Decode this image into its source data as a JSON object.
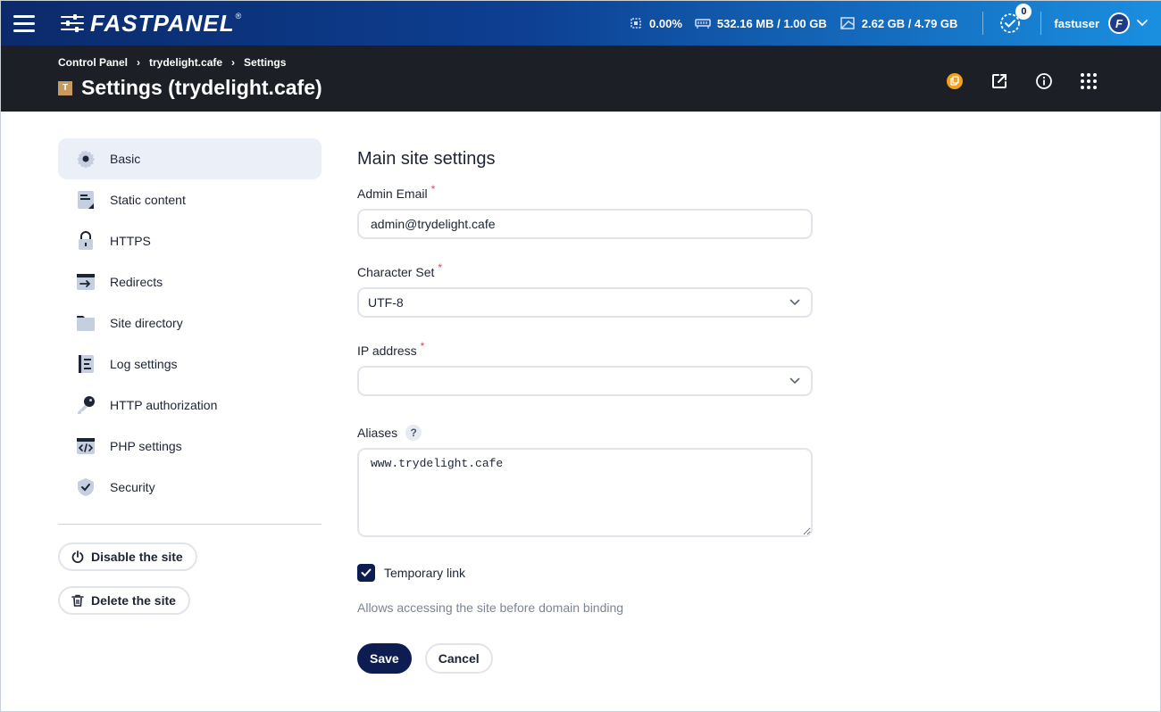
{
  "app": {
    "logo_text": "FASTPANEL",
    "logo_reg": "®"
  },
  "stats": {
    "cpu": "0.00%",
    "ram": "532.16 MB / 1.00 GB",
    "disk": "2.62 GB / 4.79 GB",
    "tasks_count": "0"
  },
  "user": {
    "name": "fastuser",
    "avatar_letter": "F"
  },
  "breadcrumb": [
    "Control Panel",
    "trydelight.cafe",
    "Settings"
  ],
  "page": {
    "site_badge": "T",
    "title": "Settings (trydelight.cafe)"
  },
  "sidebar": {
    "items": [
      {
        "label": "Basic",
        "icon": "gear-icon",
        "active": true
      },
      {
        "label": "Static content",
        "icon": "static-content-icon"
      },
      {
        "label": "HTTPS",
        "icon": "lock-icon"
      },
      {
        "label": "Redirects",
        "icon": "redirect-icon"
      },
      {
        "label": "Site directory",
        "icon": "folder-icon"
      },
      {
        "label": "Log settings",
        "icon": "log-icon"
      },
      {
        "label": "HTTP authorization",
        "icon": "key-icon"
      },
      {
        "label": "PHP settings",
        "icon": "code-icon"
      },
      {
        "label": "Security",
        "icon": "shield-icon"
      }
    ],
    "disable_label": "Disable the site",
    "delete_label": "Delete the site"
  },
  "form": {
    "section_title": "Main site settings",
    "admin_email_label": "Admin Email",
    "admin_email_value": "admin@trydelight.cafe",
    "charset_label": "Character Set",
    "charset_value": "UTF-8",
    "ip_label": "IP address",
    "ip_value": "",
    "aliases_label": "Aliases",
    "aliases_help": "?",
    "aliases_value": "www.trydelight.cafe",
    "required_mark": "*",
    "temp_link_label": "Temporary link",
    "temp_link_checked": true,
    "temp_link_hint": "Allows accessing the site before domain binding",
    "save_label": "Save",
    "cancel_label": "Cancel"
  },
  "colors": {
    "primary": "#0d1d52",
    "topbar_start": "#0c2a6b",
    "topbar_end": "#1a8fe0",
    "subbar": "#1c1f26",
    "required": "#e0434b",
    "notification": "#f5a01a"
  }
}
